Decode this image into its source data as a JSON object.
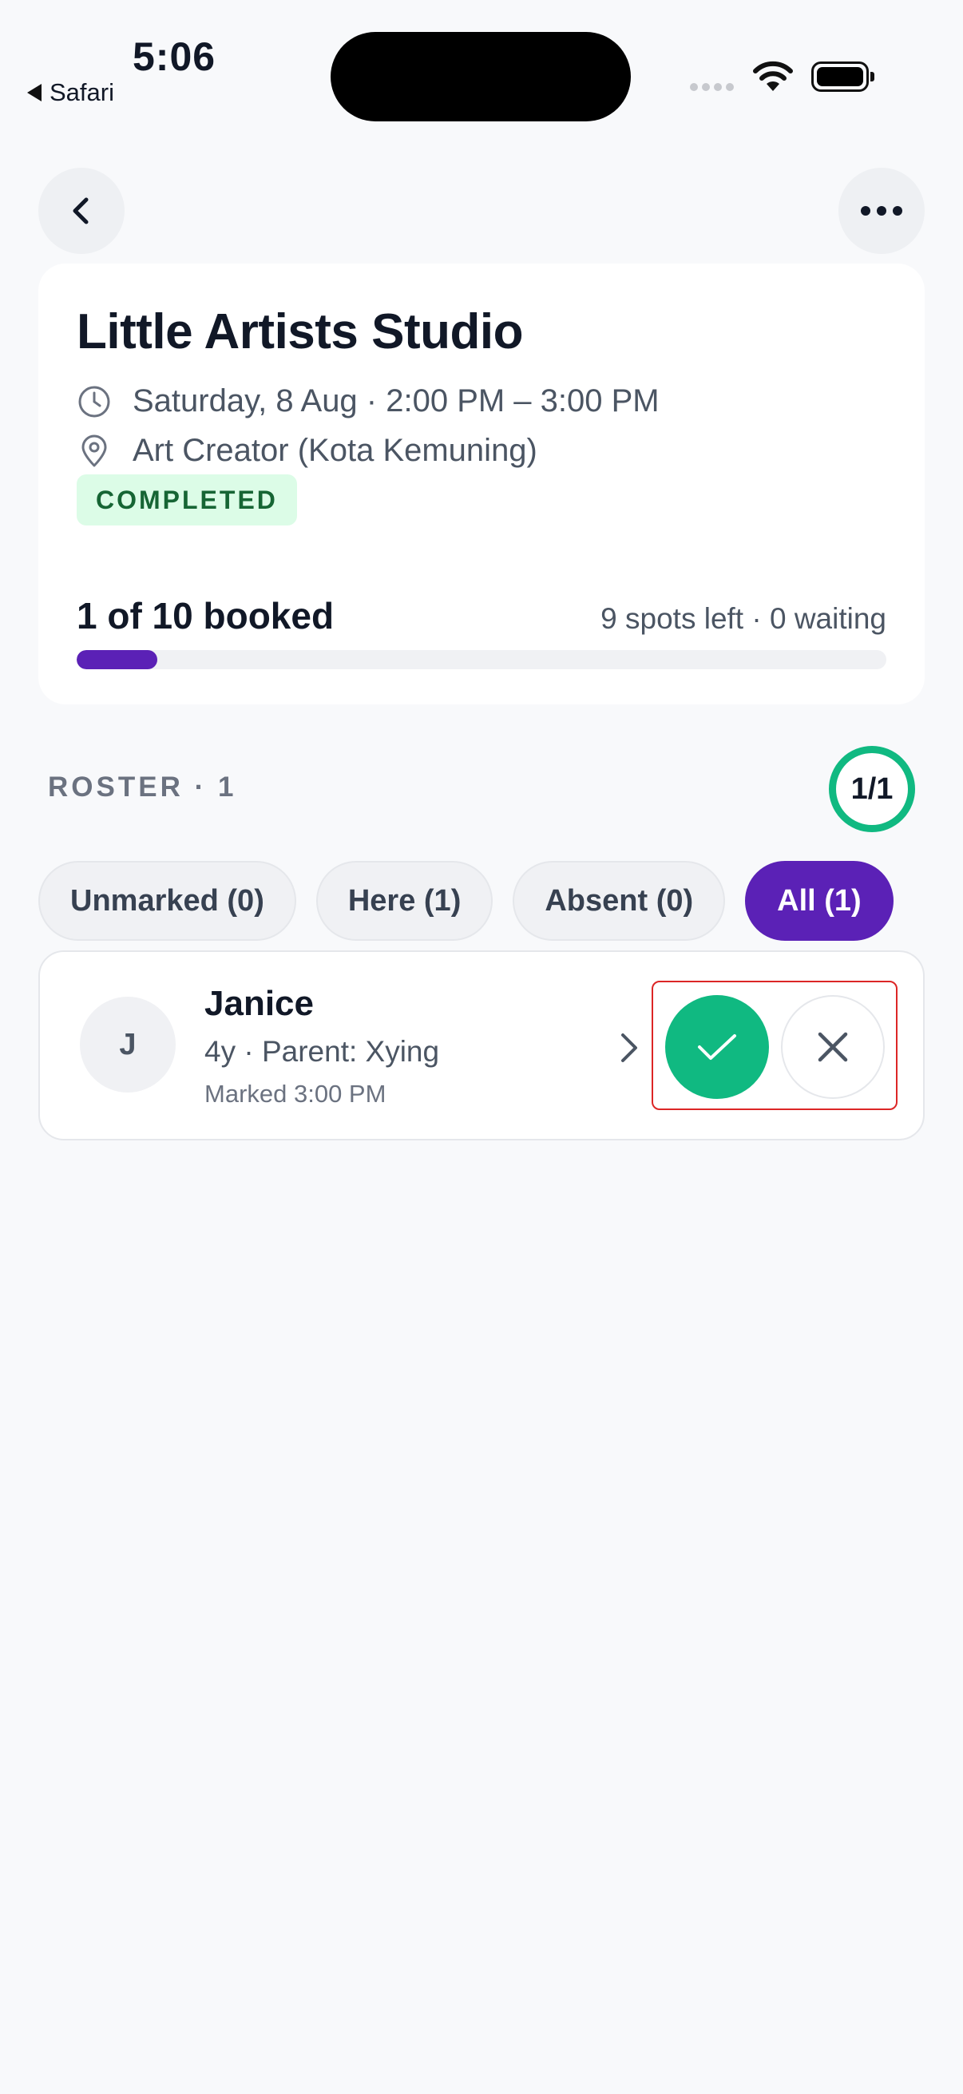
{
  "status_bar": {
    "time": "5:06",
    "back_app": "Safari"
  },
  "nav": {
    "back_icon": "chevron-left-icon",
    "more_icon": "ellipsis-icon"
  },
  "class": {
    "title": "Little Artists Studio",
    "datetime": "Saturday, 8 Aug · 2:00 PM – 3:00 PM",
    "location": "Art Creator (Kota Kemuning)",
    "status": "COMPLETED",
    "booked_label": "1 of 10 booked",
    "spots_label": "9 spots left · 0 waiting",
    "booked_fraction": 0.1
  },
  "roster": {
    "label": "ROSTER · 1",
    "attendance_ring": "1/1",
    "filters": [
      {
        "label": "Unmarked (0)",
        "active": false
      },
      {
        "label": "Here (1)",
        "active": false
      },
      {
        "label": "Absent (0)",
        "active": false
      },
      {
        "label": "All (1)",
        "active": true
      }
    ],
    "items": [
      {
        "initial": "J",
        "name": "Janice",
        "meta": "4y · Parent: Xying",
        "marked": "Marked 3:00 PM",
        "status": "here"
      }
    ]
  },
  "colors": {
    "accent": "#5b21b6",
    "success": "#10b981",
    "badge_bg": "#dcfce7",
    "badge_text": "#166534",
    "highlight": "#dc2626"
  }
}
